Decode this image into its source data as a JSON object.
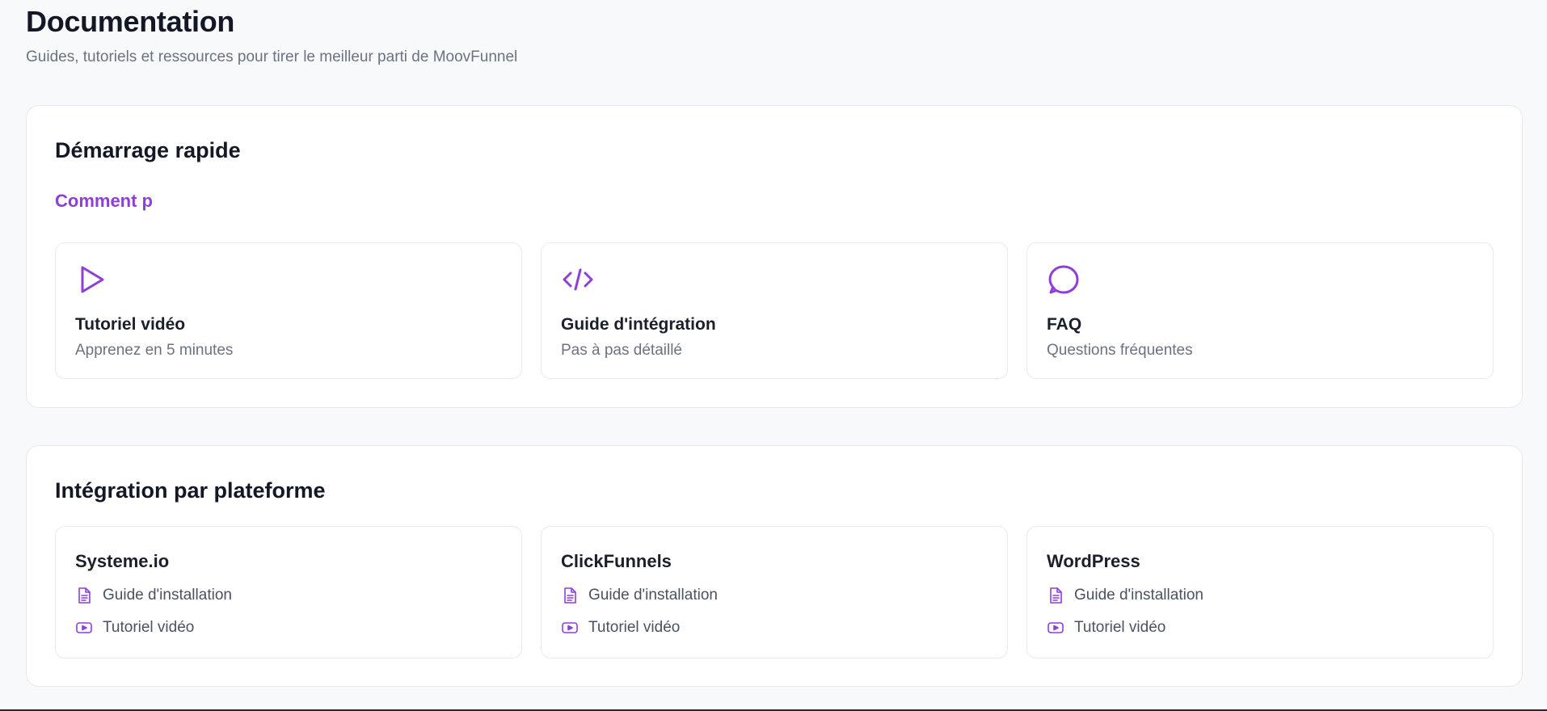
{
  "header": {
    "title": "Documentation",
    "subtitle": "Guides, tutoriels et ressources pour tirer le meilleur parti de MoovFunnel"
  },
  "quick_start": {
    "title": "Démarrage rapide",
    "link_label": "Comment p",
    "cards": [
      {
        "icon": "play-icon",
        "title": "Tutoriel vidéo",
        "description": "Apprenez en 5 minutes"
      },
      {
        "icon": "code-icon",
        "title": "Guide d'intégration",
        "description": "Pas à pas détaillé"
      },
      {
        "icon": "chat-bubble-icon",
        "title": "FAQ",
        "description": "Questions fréquentes"
      }
    ]
  },
  "platforms": {
    "title": "Intégration par plateforme",
    "cards": [
      {
        "name": "Systeme.io",
        "links": [
          {
            "icon": "document-icon",
            "label": "Guide d'installation"
          },
          {
            "icon": "video-icon",
            "label": "Tutoriel vidéo"
          }
        ]
      },
      {
        "name": "ClickFunnels",
        "links": [
          {
            "icon": "document-icon",
            "label": "Guide d'installation"
          },
          {
            "icon": "video-icon",
            "label": "Tutoriel vidéo"
          }
        ]
      },
      {
        "name": "WordPress",
        "links": [
          {
            "icon": "document-icon",
            "label": "Guide d'installation"
          },
          {
            "icon": "video-icon",
            "label": "Tutoriel vidéo"
          }
        ]
      }
    ]
  },
  "colors": {
    "accent": "#8e3fd6",
    "background": "#f8f9fb",
    "card_border": "#e9eaef",
    "heading": "#141826",
    "muted_text": "#6b7280"
  }
}
